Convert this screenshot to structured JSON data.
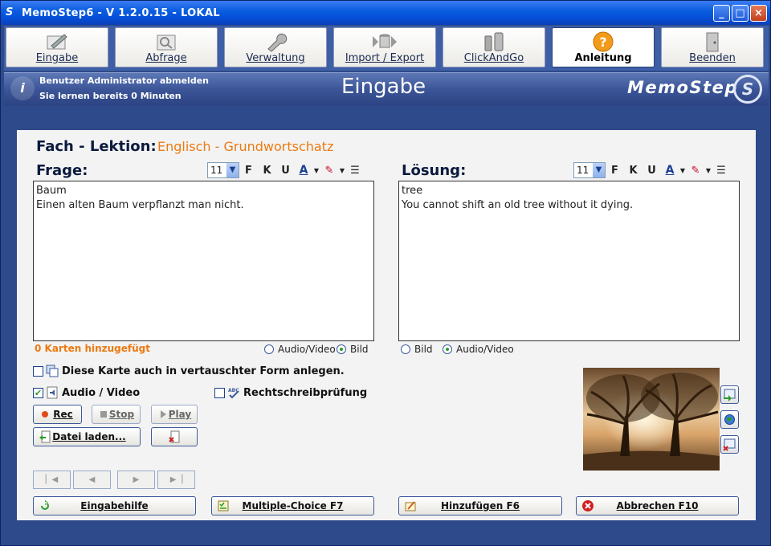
{
  "window": {
    "title": "MemoStep6 - V 1.2.0.15  -  LOKAL",
    "logo": "S"
  },
  "toolbar": [
    {
      "label": "Eingabe",
      "icon": "pencil-icon"
    },
    {
      "label": "Abfrage",
      "icon": "query-icon"
    },
    {
      "label": "Verwaltung",
      "icon": "wrench-icon"
    },
    {
      "label": "Import / Export",
      "icon": "import-export-icon"
    },
    {
      "label": "ClickAndGo",
      "icon": "phone-icon"
    },
    {
      "label": "Anleitung",
      "icon": "help-icon"
    },
    {
      "label": "Beenden",
      "icon": "door-icon"
    }
  ],
  "header": {
    "logout": "Benutzer Administrator abmelden",
    "learning": "Sie lernen bereits 0 Minuten",
    "title": "Eingabe",
    "brand": "MemoStep",
    "brand_mark": "S"
  },
  "subject": {
    "label": "Fach - Lektion:",
    "value": "Englisch - Grundwortschatz"
  },
  "question": {
    "label": "Frage:",
    "font_size": "11",
    "line1": "Baum",
    "line2": "Einen alten Baum verpflanzt man nicht."
  },
  "answer": {
    "label": "Lösung:",
    "font_size": "11",
    "line1": "tree",
    "line2": "You cannot shift an old tree without it dying."
  },
  "format": {
    "bold": "F",
    "italic": "K",
    "underline": "U",
    "font_color": "A"
  },
  "cards_added": "0 Karten hinzugefügt",
  "media_left": {
    "opt1": "Audio/Video",
    "opt2": "Bild",
    "selected": "Bild"
  },
  "media_right": {
    "opt1": "Bild",
    "opt2": "Audio/Video",
    "selected": "Audio/Video"
  },
  "reverse_card": "Diese Karte auch in vertauschter Form anlegen.",
  "audio_video": "Audio / Video",
  "spellcheck": "Rechtschreibprüfung",
  "buttons": {
    "rec": "Rec",
    "stop": "Stop",
    "play": "Play",
    "load_file": "Datei laden...",
    "input_help": "Eingabehilfe",
    "multiple_choice": "Multiple-Choice F7",
    "add": "Hinzufügen  F6",
    "cancel": "Abbrechen  F10"
  },
  "colors": {
    "accent_orange": "#ec7a12",
    "title_blue": "#0b1a3e",
    "frame_blue": "#2f4a8a"
  }
}
